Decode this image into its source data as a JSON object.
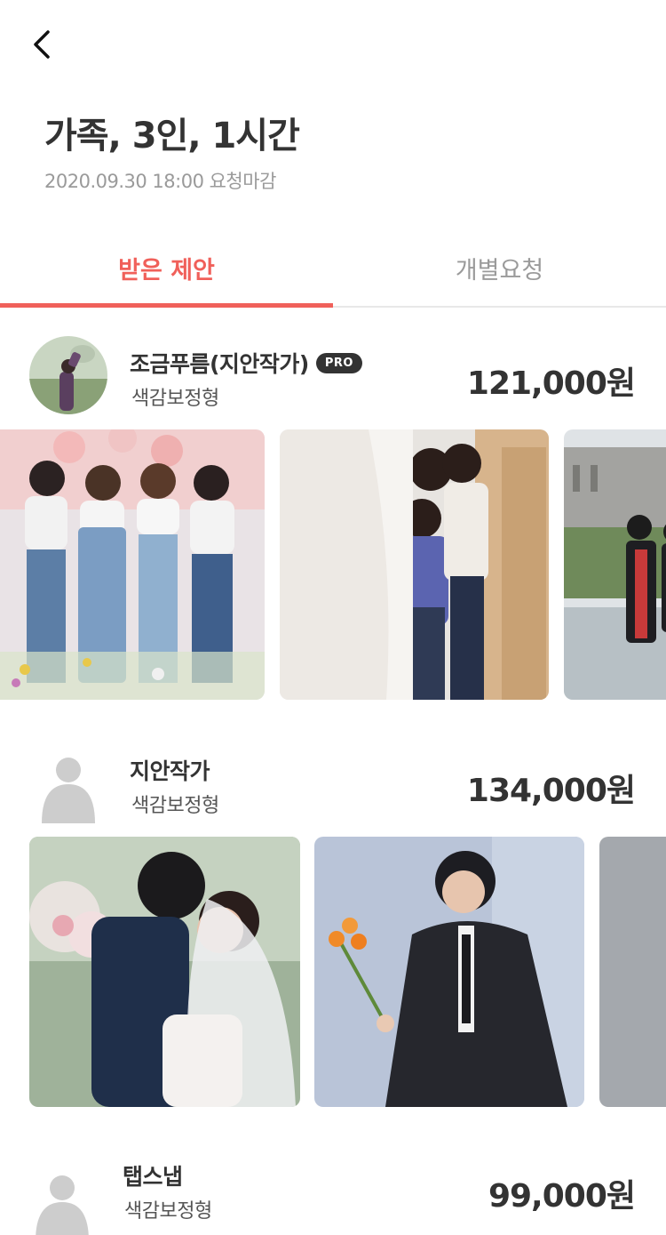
{
  "header": {
    "title": "가족, 3인, 1시간",
    "deadline": "2020.09.30 18:00 요청마감"
  },
  "tabs": [
    {
      "label": "받은 제안",
      "active": true
    },
    {
      "label": "개별요청",
      "active": false
    }
  ],
  "offers": [
    {
      "name": "조금푸름(지안작가)",
      "badge": "PRO",
      "style": "색감보정형",
      "price": "121,000원"
    },
    {
      "name": "지안작가",
      "badge": "",
      "style": "색감보정형",
      "price": "134,000원"
    },
    {
      "name": "탭스냅",
      "badge": "",
      "style": "색감보정형",
      "price": "99,000원"
    }
  ],
  "colors": {
    "accent": "#f0605a",
    "text": "#333333",
    "muted": "#9a9a9a",
    "divider": "#e8e8e8"
  },
  "icons": {
    "back": "chevron-left-icon",
    "default_avatar": "person-placeholder-icon"
  }
}
